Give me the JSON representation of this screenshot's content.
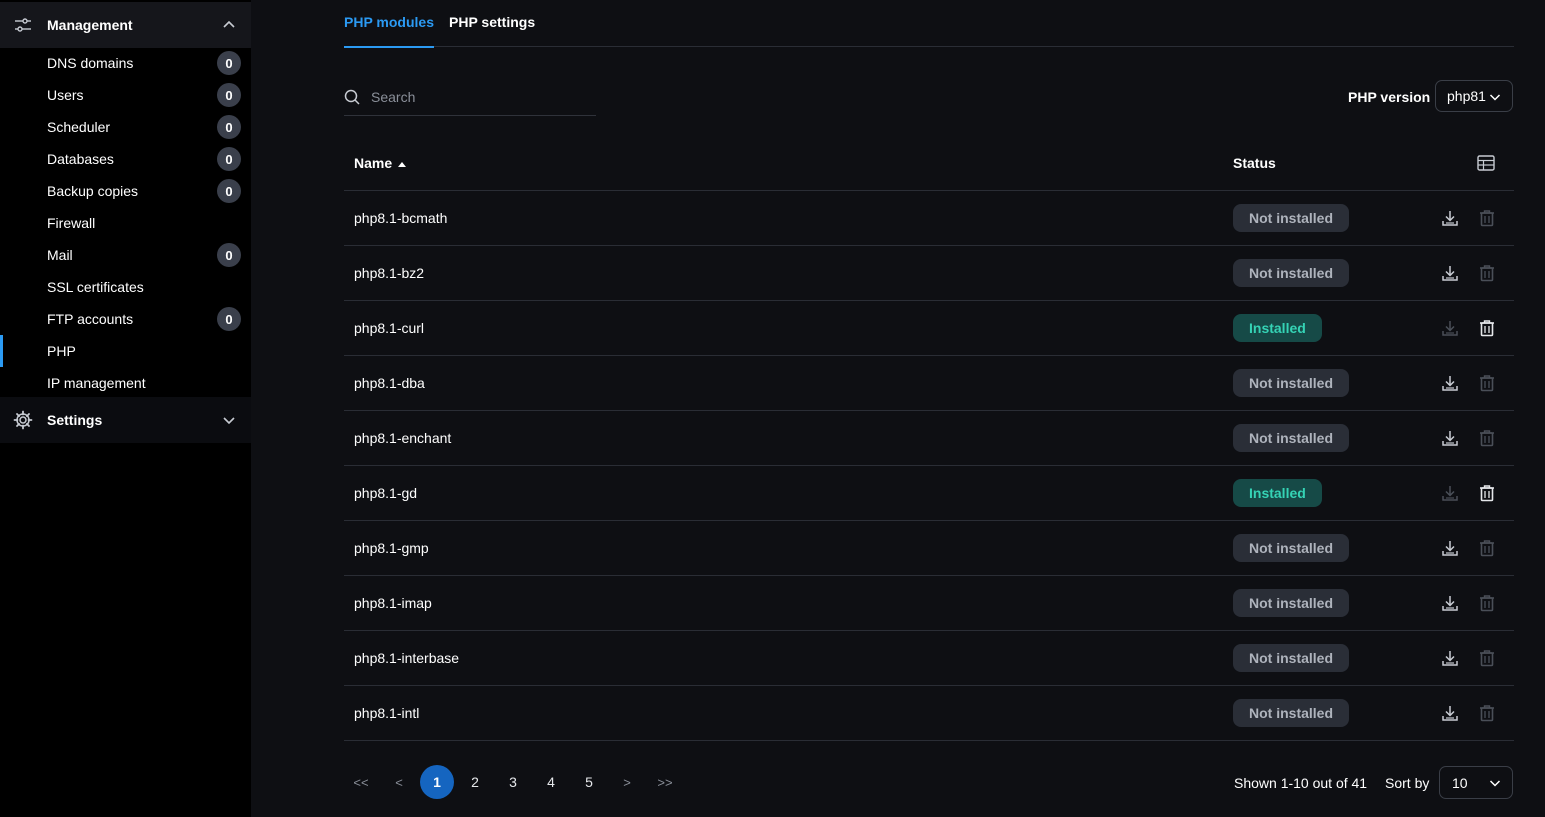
{
  "sidebar": {
    "management": {
      "label": "Management",
      "icon": "sliders-icon",
      "expanded": true
    },
    "items": [
      {
        "label": "DNS domains",
        "badge": "0"
      },
      {
        "label": "Users",
        "badge": "0"
      },
      {
        "label": "Scheduler",
        "badge": "0"
      },
      {
        "label": "Databases",
        "badge": "0"
      },
      {
        "label": "Backup copies",
        "badge": "0"
      },
      {
        "label": "Firewall",
        "badge": null
      },
      {
        "label": "Mail",
        "badge": "0"
      },
      {
        "label": "SSL certificates",
        "badge": null
      },
      {
        "label": "FTP accounts",
        "badge": "0"
      },
      {
        "label": "PHP",
        "badge": null,
        "active": true
      },
      {
        "label": "IP management",
        "badge": null
      }
    ],
    "settings": {
      "label": "Settings",
      "icon": "gear-icon",
      "expanded": false
    }
  },
  "tabs": [
    {
      "label": "PHP modules",
      "active": true
    },
    {
      "label": "PHP settings",
      "active": false
    }
  ],
  "search": {
    "placeholder": "Search",
    "value": ""
  },
  "php_version": {
    "label": "PHP version",
    "value": "php81"
  },
  "table": {
    "columns": {
      "name": "Name",
      "status": "Status"
    },
    "rows": [
      {
        "name": "php8.1-bcmath",
        "status": "Not installed",
        "installed": false
      },
      {
        "name": "php8.1-bz2",
        "status": "Not installed",
        "installed": false
      },
      {
        "name": "php8.1-curl",
        "status": "Installed",
        "installed": true
      },
      {
        "name": "php8.1-dba",
        "status": "Not installed",
        "installed": false
      },
      {
        "name": "php8.1-enchant",
        "status": "Not installed",
        "installed": false
      },
      {
        "name": "php8.1-gd",
        "status": "Installed",
        "installed": true
      },
      {
        "name": "php8.1-gmp",
        "status": "Not installed",
        "installed": false
      },
      {
        "name": "php8.1-imap",
        "status": "Not installed",
        "installed": false
      },
      {
        "name": "php8.1-interbase",
        "status": "Not installed",
        "installed": false
      },
      {
        "name": "php8.1-intl",
        "status": "Not installed",
        "installed": false
      }
    ]
  },
  "pagination": {
    "first": "<<",
    "prev": "<",
    "next": ">",
    "last": ">>",
    "pages": [
      "1",
      "2",
      "3",
      "4",
      "5"
    ],
    "current": "1",
    "shown_text": "Shown 1-10 out of 41",
    "sort_label": "Sort by",
    "sort_value": "10"
  },
  "colors": {
    "accent": "#2b9af3",
    "installed_bg": "#164a47",
    "installed_text": "#35d3b5",
    "not_installed_bg": "#2a2e37",
    "page_active": "#1565c0"
  }
}
